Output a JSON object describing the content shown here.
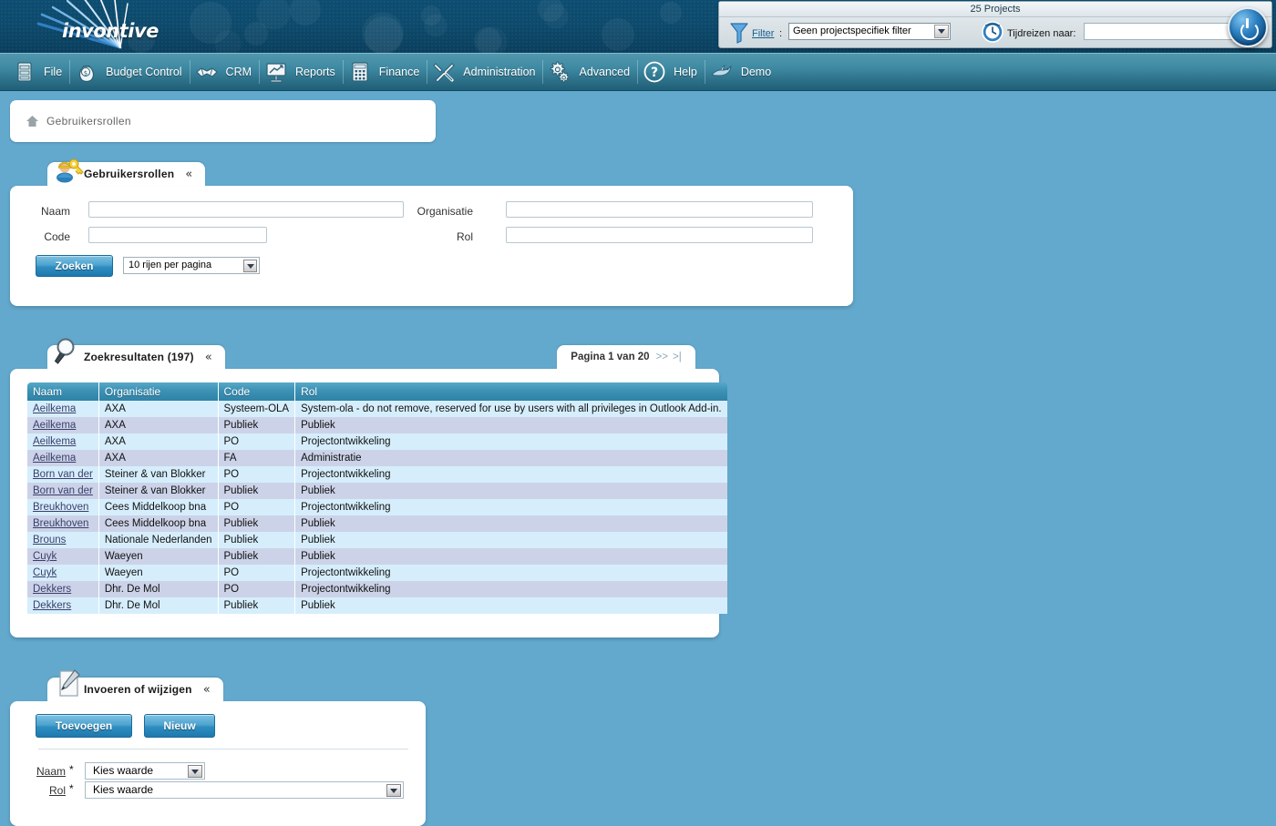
{
  "header": {
    "logo_text": "invontive",
    "project_count": "25 Projects",
    "filter_label": "Filter",
    "filter_colon": ":",
    "filter_value": "Geen projectspecifiek filter",
    "timetravel_label": "Tijdreizen naar:",
    "timetravel_value": "",
    "power_title": "power-button"
  },
  "nav": {
    "items": [
      {
        "label": "File",
        "icon": "cabinet-icon"
      },
      {
        "label": "Budget Control",
        "icon": "money-bag-icon"
      },
      {
        "label": "CRM",
        "icon": "handshake-icon"
      },
      {
        "label": "Reports",
        "icon": "presentation-chart-icon"
      },
      {
        "label": "Finance",
        "icon": "calculator-icon"
      },
      {
        "label": "Administration",
        "icon": "tools-icon"
      },
      {
        "label": "Advanced",
        "icon": "gears-icon"
      },
      {
        "label": "Help",
        "icon": "question-circle-icon"
      },
      {
        "label": "Demo",
        "icon": "dolphin-icon"
      }
    ]
  },
  "breadcrumb": {
    "text": "Gebruikersrollen",
    "home_icon": "home-icon"
  },
  "search_panel": {
    "title": "Gebruikersrollen",
    "collapse_glyph": "«",
    "labels": {
      "naam": "Naam",
      "code": "Code",
      "organisatie": "Organisatie",
      "rol": "Rol"
    },
    "values": {
      "naam": "",
      "code": "",
      "organisatie": "",
      "rol": ""
    },
    "search_button": "Zoeken",
    "rows_per_page": "10 rijen per pagina"
  },
  "results_panel": {
    "title": "Zoekresultaten (197)",
    "collapse_glyph": "«",
    "pager": {
      "text": "Pagina 1 van 20",
      "next": ">>",
      "last": ">|"
    },
    "columns": [
      "Naam",
      "Organisatie",
      "Code",
      "Rol"
    ],
    "rows": [
      [
        "Aeilkema",
        "AXA",
        "Systeem-OLA",
        "System-ola - do not remove, reserved for use by users with all privileges in Outlook Add-in."
      ],
      [
        "Aeilkema",
        "AXA",
        "Publiek",
        "Publiek"
      ],
      [
        "Aeilkema",
        "AXA",
        "PO",
        "Projectontwikkeling"
      ],
      [
        "Aeilkema",
        "AXA",
        "FA",
        "Administratie"
      ],
      [
        "Born van der",
        "Steiner & van Blokker",
        "PO",
        "Projectontwikkeling"
      ],
      [
        "Born van der",
        "Steiner & van Blokker",
        "Publiek",
        "Publiek"
      ],
      [
        "Breukhoven",
        "Cees Middelkoop bna",
        "PO",
        "Projectontwikkeling"
      ],
      [
        "Breukhoven",
        "Cees Middelkoop bna",
        "Publiek",
        "Publiek"
      ],
      [
        "Brouns",
        "Nationale Nederlanden",
        "Publiek",
        "Publiek"
      ],
      [
        "Cuyk",
        "Waeyen",
        "Publiek",
        "Publiek"
      ],
      [
        "Cuyk",
        "Waeyen",
        "PO",
        "Projectontwikkeling"
      ],
      [
        "Dekkers",
        "Dhr. De Mol",
        "PO",
        "Projectontwikkeling"
      ],
      [
        "Dekkers",
        "Dhr. De Mol",
        "Publiek",
        "Publiek"
      ]
    ]
  },
  "edit_panel": {
    "title": "Invoeren of wijzigen",
    "collapse_glyph": "«",
    "add_button": "Toevoegen",
    "new_button": "Nieuw",
    "naam_label": "Naam",
    "rol_label": "Rol",
    "required_mark": "*",
    "naam_value": "Kies waarde",
    "rol_value": "Kies waarde"
  },
  "colors": {
    "page_background": "#62a9cd",
    "banner_dark": "#0d4d71",
    "nav_teal": "#3f8aa3",
    "grid_header": "#3e93b6",
    "row_odd": "#d6eefc",
    "row_even": "#ccd3e8",
    "link": "#3a3f6b",
    "accent_button": "#2f8ec1"
  }
}
